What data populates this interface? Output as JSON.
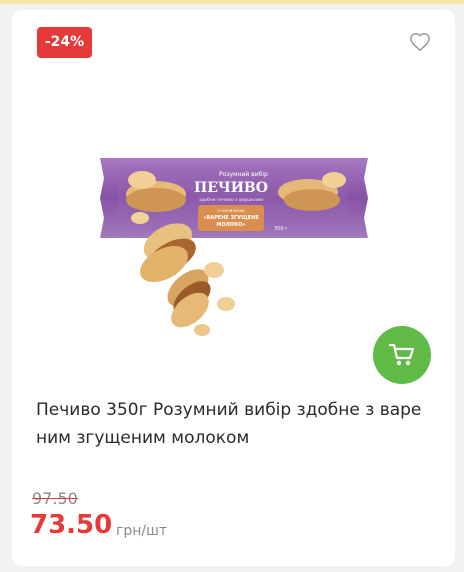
{
  "product_card": {
    "discount_badge": "-24%",
    "title": "Печиво 350г Розумний вибір здобне з варе ним згущеним молоком",
    "old_price": "97.50",
    "price": "73.50",
    "unit": "грн/шт",
    "package": {
      "brand": "Розумний вибір",
      "name": "ПЕЧИВО",
      "subtitle": "здобне печиво з вершками",
      "flavor_line1": "з начинкою",
      "flavor_line2": "«ВАРЕНЕ ЗГУЩЕНЕ",
      "flavor_line3": "МОЛОКО»",
      "weight": "350 г"
    },
    "icons": {
      "favorite": "heart-outline-icon",
      "cart": "cart-icon"
    },
    "colors": {
      "discount": "#e5393a",
      "cart_button": "#5fba46",
      "package": "#8a5aa6"
    }
  }
}
